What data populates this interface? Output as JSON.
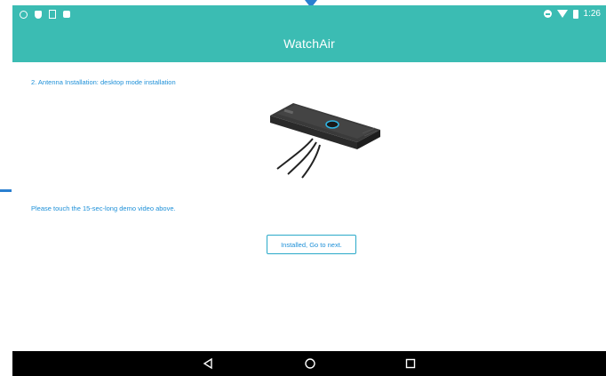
{
  "app": {
    "title": "WatchAir"
  },
  "status_bar": {
    "time": "1:26"
  },
  "content": {
    "step_title": "2. Antenna Installation: desktop mode installation",
    "instruction": "Please touch the 15-sec-long demo video above.",
    "next_button_label": "Installed, Go to next."
  },
  "icons": {
    "status_left": [
      "notification-icon",
      "shield-icon",
      "sim-icon",
      "square-icon"
    ],
    "status_right": [
      "dnd-icon",
      "wifi-icon",
      "battery-icon"
    ],
    "nav": [
      "back-icon",
      "home-icon",
      "recents-icon"
    ]
  },
  "colors": {
    "header": "#3bbcb3",
    "text_accent": "#1e90d8",
    "button_border": "#2aa9c9",
    "nav_bar": "#000000"
  }
}
